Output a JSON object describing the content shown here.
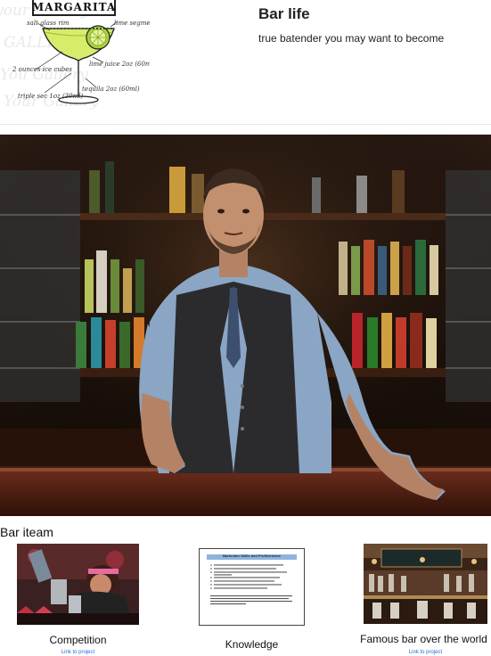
{
  "header": {
    "logo": {
      "banner_text": "MARGARITA",
      "notes": [
        "salt glass rim",
        "lime segment",
        "2 ounces ice cubes",
        "lime juice 2oz (60ml)",
        "triple sec 1oz (30ml)",
        "tequila 2oz (60ml)"
      ],
      "background_words": [
        "your Gallery",
        "GALLERY",
        "You Gallery",
        "Your Gallery"
      ]
    },
    "title": "Bar life",
    "subtitle": "true batender you may want to become"
  },
  "hero": {
    "icon": "bartender-photo"
  },
  "items_section": {
    "title": "Bar iteam",
    "cards": [
      {
        "label": "Competition",
        "link": "Link to project",
        "icon": "competition-photo"
      },
      {
        "label": "Knowledge",
        "link": "",
        "icon": "document-thumbnail",
        "doc_title": "Bartender Skills and Proficiencies"
      },
      {
        "label": "Famous bar over the world",
        "link": "Link to project",
        "icon": "bar-interior-photo"
      }
    ]
  }
}
